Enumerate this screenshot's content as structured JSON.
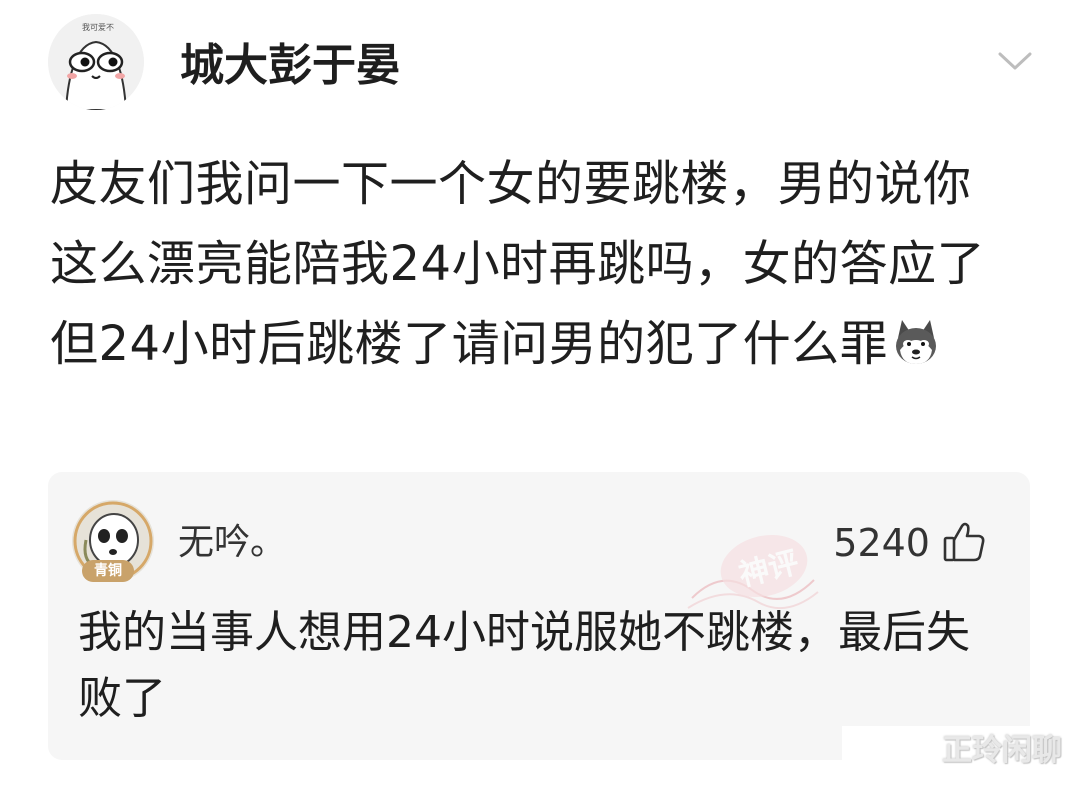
{
  "post": {
    "author": "城大彭于晏",
    "avatar_icon": "cartoon-face-icon",
    "avatar_caption": "我可爱不",
    "text": "皮友们我问一下一个女的要跳楼，男的说你这么漂亮能陪我24小时再跳吗，女的答应了但24小时后跳楼了请问男的犯了什么罪",
    "emoji_icon": "husky-dog-emoji-icon",
    "menu_icon": "chevron-down-icon"
  },
  "comment": {
    "user": "无吟。",
    "badge": "青铜",
    "likes": "5240",
    "like_icon": "thumbs-up-icon",
    "stamp": "神评",
    "text": "我的当事人想用24小时说服她不跳楼，最后失败了"
  },
  "watermark": "正玲闲聊",
  "colors": {
    "card_bg": "#f6f6f6",
    "stamp": "#e8a0a6",
    "badge": "#c9a26a"
  }
}
